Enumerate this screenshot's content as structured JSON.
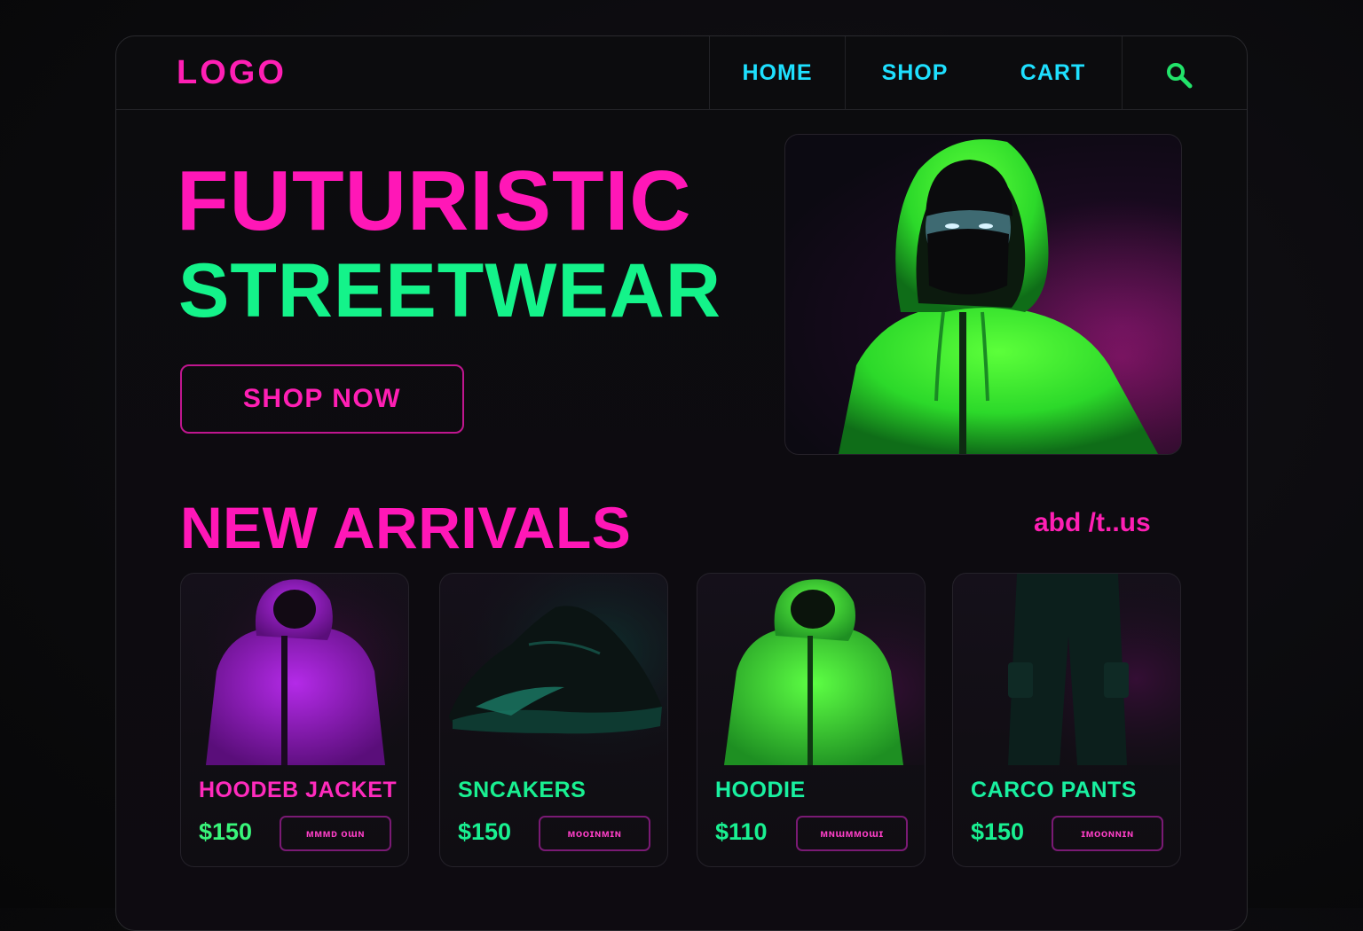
{
  "header": {
    "logo": "LOGO",
    "nav": [
      {
        "label": "HOME"
      },
      {
        "label": "SHOP"
      },
      {
        "label": "CART"
      }
    ],
    "search_icon": "search-icon"
  },
  "hero": {
    "title_line1": "FUTURISTIC",
    "title_line2": "STREETWEAR",
    "cta_label": "SHOP NOW",
    "image": "person in green hoodie with black face mask"
  },
  "arrivals": {
    "title": "NEW ARRIVALS",
    "link_label": "abd /t..us",
    "products": [
      {
        "name": "HOODEB JACKET",
        "price": "$150",
        "button": "ᴍᴍᴍᴅ ᴏɯɴ",
        "name_color": "#ff2bbd",
        "price_color": "#39f57a"
      },
      {
        "name": "SNCAKERS",
        "price": "$150",
        "button": "ᴍᴏᴏɪɴᴍɪɴ",
        "name_color": "#19f091",
        "price_color": "#19f091"
      },
      {
        "name": "HOODIE",
        "price": "$110",
        "button": "ᴍɴɯᴍᴍᴏɯɪ",
        "name_color": "#19f0a0",
        "price_color": "#19f091"
      },
      {
        "name": "CARCO PANTS",
        "price": "$150",
        "button": "ɪᴍᴏᴏɴɴɪɴ",
        "name_color": "#19f0a0",
        "price_color": "#19f091"
      }
    ]
  },
  "colors": {
    "magenta": "#ff17b7",
    "green": "#14f38a",
    "cyan": "#1ee0ff",
    "background": "#0b0b0d"
  }
}
